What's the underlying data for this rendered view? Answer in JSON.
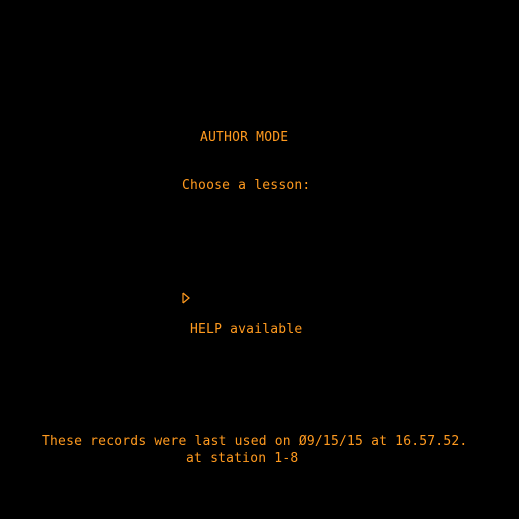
{
  "colors": {
    "background": "#000000",
    "text": "#ff9a1f"
  },
  "screen": {
    "title": "AUTHOR MODE",
    "prompt": "Choose a lesson:",
    "input_arrow_icon": "arrow-right-icon",
    "help_text": "HELP available",
    "records_line": "These records were last used on Ø9/15/15 at 16.57.52.",
    "station_line": "at station 1-8"
  }
}
